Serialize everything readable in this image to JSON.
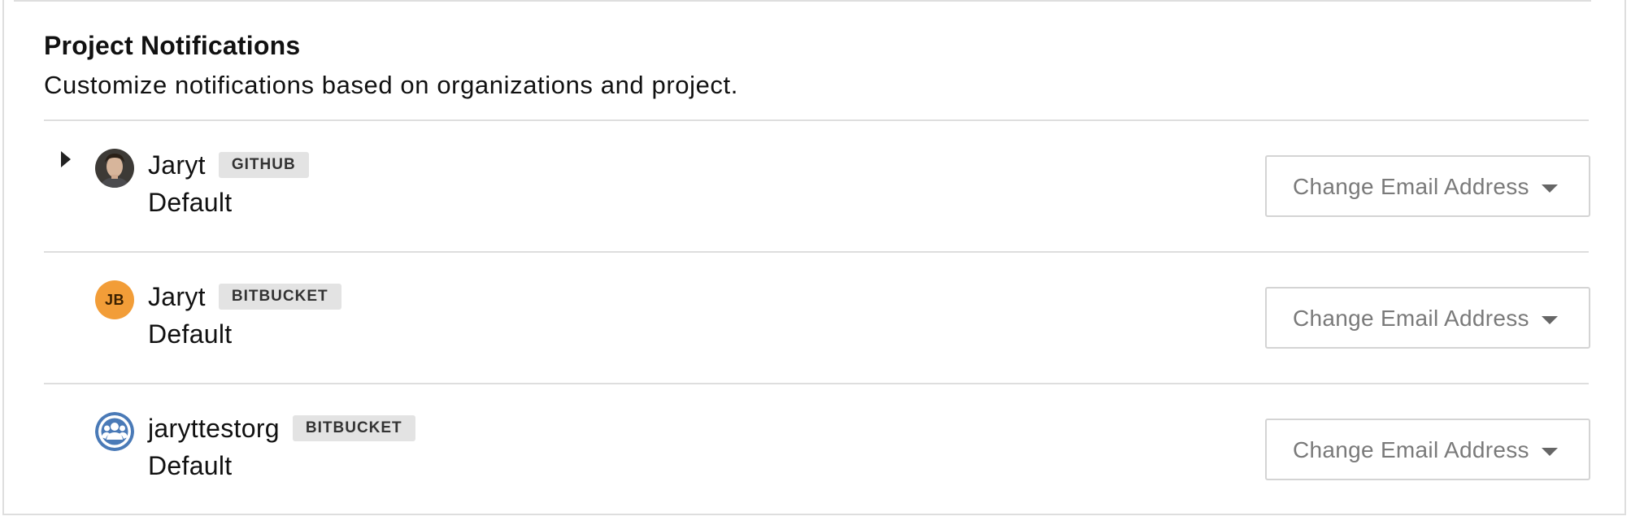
{
  "section": {
    "title": "Project Notifications",
    "description": "Customize notifications based on organizations and project."
  },
  "accounts": [
    {
      "name": "Jaryt",
      "vcs": "GITHUB",
      "setting": "Default",
      "avatar": "photo",
      "expandable": true,
      "dropdown_label": "Change Email Address"
    },
    {
      "name": "Jaryt",
      "vcs": "BITBUCKET",
      "setting": "Default",
      "avatar": "initials",
      "avatar_initials": "JB",
      "expandable": false,
      "dropdown_label": "Change Email Address"
    },
    {
      "name": "jaryttestorg",
      "vcs": "BITBUCKET",
      "setting": "Default",
      "avatar": "org-icon",
      "expandable": false,
      "dropdown_label": "Change Email Address"
    }
  ],
  "colors": {
    "initials_avatar": "#f29d38",
    "org_avatar": "#4a7ab7",
    "badge_background": "#e3e3e3",
    "divider": "#dedede"
  },
  "icons": {
    "expander": "caret-right-icon",
    "dropdown": "chevron-down-icon",
    "org": "team-icon"
  }
}
